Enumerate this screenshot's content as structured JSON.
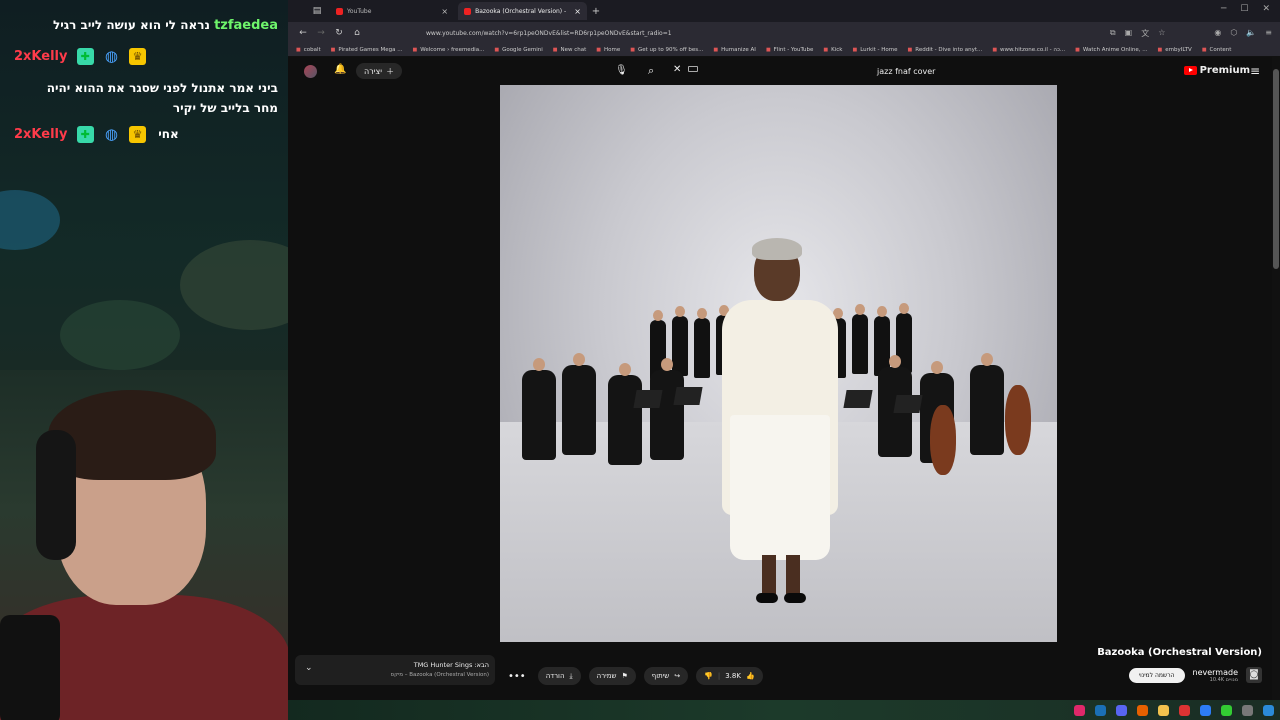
{
  "chat": [
    {
      "user": "tzfaedea",
      "message": "נראה לי הוא עושה לייב רגיל",
      "color": "#6ef56b",
      "badges": []
    },
    {
      "user": "2xKelly",
      "message": "",
      "color": "#ff3b4a",
      "badges": [
        "gift-icon",
        "globe-icon",
        "crown-icon"
      ]
    },
    {
      "user": "",
      "message": "ביני אמר אתנול לפני שסגר את ההוא יהיה מחר בלייב של יקיר",
      "color": "#ffffff",
      "badges": []
    },
    {
      "user": "2xKelly",
      "message": "אחי",
      "color": "#ff3b4a",
      "badges": [
        "gift-icon",
        "globe-icon",
        "crown-icon"
      ]
    }
  ],
  "browser": {
    "tabs": [
      {
        "title": "YouTube",
        "active": false
      },
      {
        "title": "Bazooka (Orchestral Version) - ",
        "active": true
      }
    ],
    "new_tab": "+",
    "url": "www.youtube.com/watch?v=6rp1peONDvE&list=RD6rp1peONDvE&start_radio=1",
    "bookmarks": [
      "cobalt",
      "Pirated Games Mega ...",
      "Welcome › freemedia...",
      "Google Gemini",
      "New chat",
      "Home",
      "Get up to 90% off bes...",
      "Humanize AI",
      "Flint - YouTube",
      "Kick",
      "Lurkit - Home",
      "Reddit - Dive into anyt...",
      "www.hitzone.co.il - כה...",
      "Watch Anime Online, ...",
      "embyILTV",
      "Content"
    ]
  },
  "youtube": {
    "logo_text": "Premium",
    "search_query": "jazz fnaf cover",
    "create_label": "יצירה",
    "video_title": "Bazooka (Orchestral Version)",
    "channel_name": "nevermade",
    "channel_subs": "10.4K מנויים",
    "subscribe_label": "הרשמה למינוי",
    "likes": "3.8K",
    "share_label": "שיתוף",
    "save_label": "שמירה",
    "download_label": "הורדה",
    "upnext_title": "TMG Hunter Sings :הבא",
    "upnext_sub": "מיקס – Bazooka (Orchestral Version)"
  },
  "colors": {
    "accent": "#ff0000",
    "chat_green": "#6ef56b",
    "chat_red": "#ff3b4a"
  }
}
